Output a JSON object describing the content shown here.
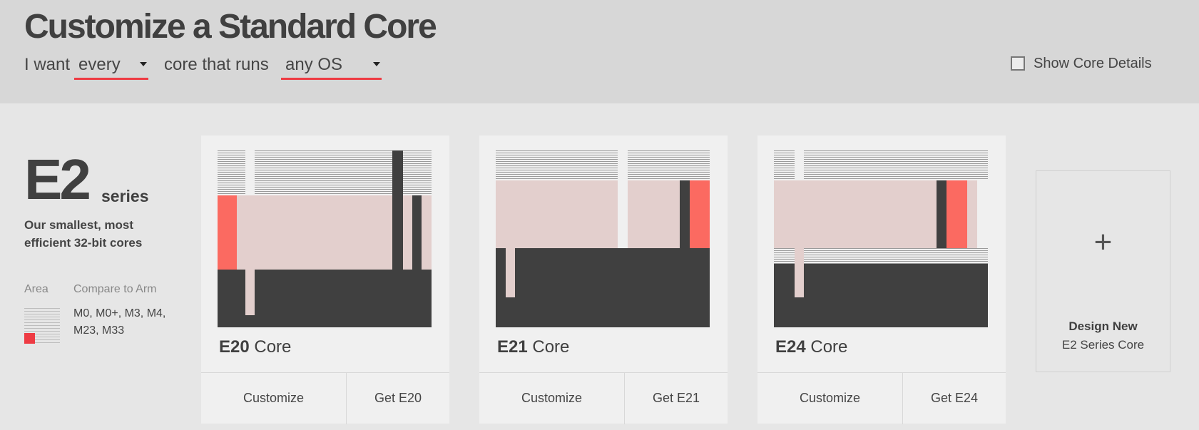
{
  "header": {
    "title": "Customize a Standard Core",
    "filter": {
      "prefix": "I want",
      "selection": "every",
      "middle": "core that runs",
      "os": "any OS"
    },
    "show_details_label": "Show Core Details",
    "show_details_checked": false
  },
  "series": {
    "name": "E2",
    "suffix": "series",
    "description": "Our smallest, most efficient 32-bit cores",
    "area_label": "Area",
    "compare_label": "Compare to Arm",
    "compare_values": "M0, M0+, M3, M4, M23, M33",
    "area_swatch_icon": "area-swatch-icon"
  },
  "cards": [
    {
      "name": "E20",
      "suffix": "Core",
      "customize_label": "Customize",
      "get_label": "Get E20"
    },
    {
      "name": "E21",
      "suffix": "Core",
      "customize_label": "Customize",
      "get_label": "Get E21"
    },
    {
      "name": "E24",
      "suffix": "Core",
      "customize_label": "Customize",
      "get_label": "Get E24"
    }
  ],
  "design_new": {
    "icon": "plus-icon",
    "title": "Design New",
    "subtitle": "E2 Series Core"
  },
  "colors": {
    "accent": "#ee3b43",
    "core_red": "#fb6a61",
    "core_pink": "#e3cfcd",
    "core_dark": "#404040"
  }
}
